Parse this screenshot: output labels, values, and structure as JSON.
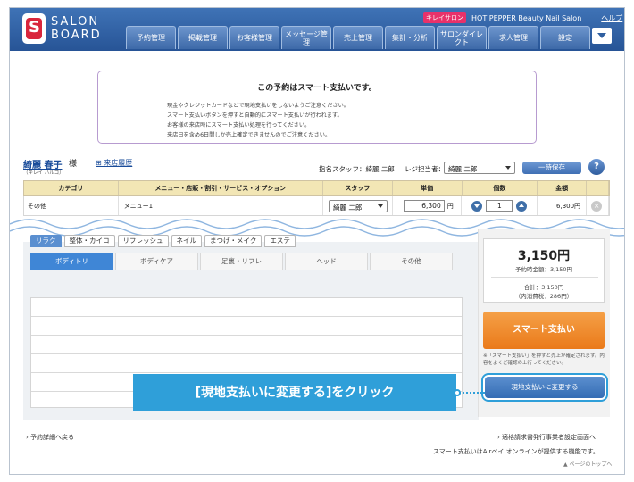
{
  "header": {
    "logo_line1": "SALON",
    "logo_line2": "BOARD",
    "kirei_badge": "キレイサロン",
    "brand_name": "HOT PEPPER Beauty Nail Salon",
    "help_label": "ヘルプ",
    "nav": [
      "予約管理",
      "掲載管理",
      "お客様管理",
      "メッセージ管理",
      "売上管理",
      "集計・分析",
      "サロンダイレクト",
      "求人管理",
      "設定"
    ]
  },
  "notice": {
    "title": "この予約はスマート支払いです。",
    "lines": [
      "現金やクレジットカードなどで現地支払いをしないようご注意ください。",
      "スマート支払いボタンを押すと自動的にスマート支払いが行われます。",
      "お客様の来店時にスマート支払い処理を行ってください。",
      "来店日を含め6日間しか売上確定できませんのでご注意ください。"
    ]
  },
  "customer": {
    "name": "綺麗 春子",
    "honorific": "様",
    "kana": "（キレイ ハルコ）",
    "visit_history_label": "来店履歴",
    "designated_staff": "指名スタッフ：綺麗 二郎",
    "register_staff_label": "レジ担当者：",
    "register_staff_value": "綺麗 二郎",
    "save_label": "一時保存",
    "help_icon": "?"
  },
  "table": {
    "headers": [
      "カテゴリ",
      "メニュー・店販・割引・サービス・オプション",
      "スタッフ",
      "単価",
      "個数",
      "金額",
      ""
    ],
    "row": {
      "category": "その他",
      "menu": "メニュー1",
      "staff": "綺麗 二郎",
      "unit_price": "6,300",
      "yen": "円",
      "quantity": "1",
      "amount": "6,300円"
    }
  },
  "menu_panel": {
    "category_tabs": [
      "リラク",
      "整体・カイロ",
      "リフレッシュ",
      "ネイル",
      "まつげ・メイク",
      "エステ"
    ],
    "active_category": 0,
    "sub_tabs": [
      "ボディトリ",
      "ボディケア",
      "足裏・リフレ",
      "ヘッド",
      "その他"
    ],
    "active_sub_tab": 0
  },
  "summary": {
    "amount": "3,150円",
    "amount_label": "予約時金額：3,150円",
    "total": "合計：3,150円",
    "tax": "（内消費税：286円）",
    "smart_pay_label": "スマート支払い",
    "smart_note_line1": "※「スマート支払い」を押すと売上が確定されます。内容をよくご確認の上行ってください。",
    "change_label": "現地支払いに変更する"
  },
  "callout": "[現地支払いに変更する]をクリック",
  "footer": {
    "back_link": "予約詳細へ戻る",
    "invoice_link": "適格請求書発行事業者設定画面へ",
    "airpay_note": "スマート支払いはAirペイ オンラインが提供する機能です。",
    "page_top": "ページのトップへ"
  },
  "colors": {
    "header_blue": "#275496",
    "smart_orange": "#ea7a1a",
    "callout_blue": "#2f9fd9",
    "table_header": "#f2e6b5"
  }
}
